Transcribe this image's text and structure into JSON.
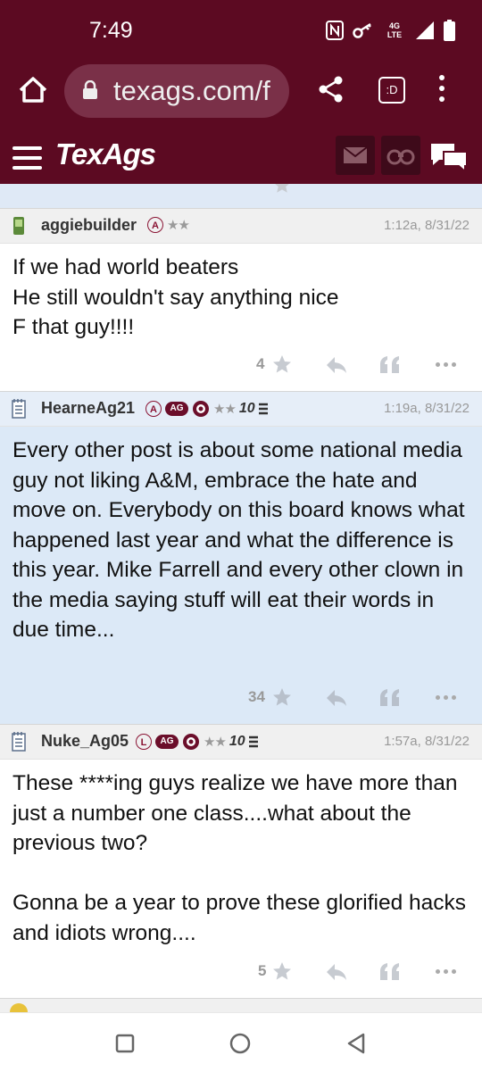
{
  "status_bar": {
    "time": "7:49",
    "network": "4G LTE"
  },
  "browser": {
    "url": "texags.com/f"
  },
  "site": {
    "logo": "TexAgs"
  },
  "posts": [
    {
      "username": "aggiebuilder",
      "badges": [
        "A",
        "★★"
      ],
      "time": "1:12a, 8/31/22",
      "body": "If we had world beaters\nHe still wouldn't say anything nice\nF that guy!!!!",
      "likes": "4"
    },
    {
      "username": "HearneAg21",
      "badges": [
        "A",
        "AG",
        "★★",
        "10"
      ],
      "time": "1:19a, 8/31/22",
      "body": "Every other post is about some national media guy not liking A&M, embrace the hate and move on. Everybody on this board knows what happened last year and what the difference is this year. Mike Farrell and every other clown in the media saying stuff will eat their words in due time...",
      "likes": "34"
    },
    {
      "username": "Nuke_Ag05",
      "badges": [
        "L",
        "AG",
        "★★",
        "10"
      ],
      "time": "1:57a, 8/31/22",
      "body": "These ****ing guys realize we have more than just a number one class....what about the previous two?\n\nGonna be a year to prove these glorified hacks and idiots wrong....",
      "likes": "5"
    }
  ],
  "colors": {
    "maroon": "#5c0a22",
    "highlight": "#dce9f7"
  }
}
